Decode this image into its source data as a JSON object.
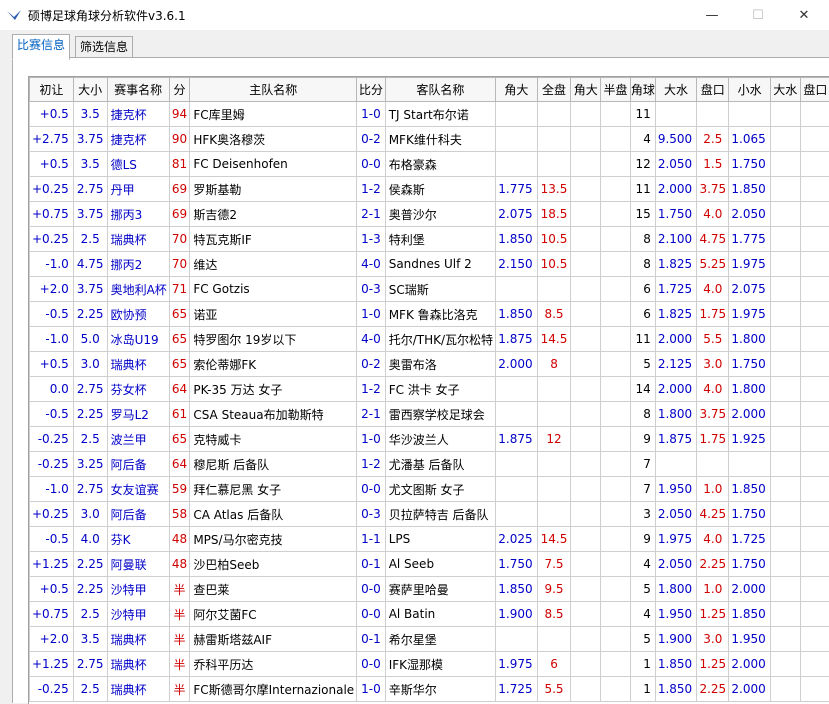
{
  "window": {
    "title": "硕博足球角球分析软件v3.6.1",
    "min_glyph": "—",
    "max_glyph": "☐",
    "close_glyph": "✕"
  },
  "tabs": [
    {
      "label": "比赛信息",
      "active": true
    },
    {
      "label": "筛选信息",
      "active": false
    }
  ],
  "grid": {
    "headers": [
      "初让",
      "大小",
      "赛事名称",
      "分",
      "主队名称",
      "比分",
      "客队名称",
      "角大",
      "全盘",
      "角大",
      "半盘",
      "角球",
      "大水",
      "盘口",
      "小水",
      "大水",
      "盘口"
    ],
    "rows": [
      [
        "+0.5",
        "3.5",
        "捷克杯",
        "94",
        "FC库里姆",
        "1-0",
        "TJ Start布尔诺",
        "",
        "",
        "",
        "",
        "11",
        "",
        "",
        ""
      ],
      [
        "+2.75",
        "3.75",
        "捷克杯",
        "90",
        "HFK奥洛穆茨",
        "0-2",
        "MFK维什科夫",
        "",
        "",
        "",
        "",
        "4",
        "9.500",
        "2.5",
        "1.065"
      ],
      [
        "+0.5",
        "3.5",
        "德LS",
        "81",
        "FC Deisenhofen",
        "0-0",
        "布格豪森",
        "",
        "",
        "",
        "",
        "12",
        "2.050",
        "1.5",
        "1.750"
      ],
      [
        "+0.25",
        "2.75",
        "丹甲",
        "69",
        "罗斯基勒",
        "1-2",
        "侯森斯",
        "1.775",
        "13.5",
        "",
        "",
        "11",
        "2.000",
        "3.75",
        "1.850"
      ],
      [
        "+0.75",
        "3.75",
        "挪丙3",
        "69",
        "斯吉德2",
        "2-1",
        "奥普沙尔",
        "2.075",
        "18.5",
        "",
        "",
        "15",
        "1.750",
        "4.0",
        "2.050"
      ],
      [
        "+0.25",
        "2.5",
        "瑞典杯",
        "70",
        "特瓦克斯IF",
        "1-3",
        "特利堡",
        "1.850",
        "10.5",
        "",
        "",
        "8",
        "2.100",
        "4.75",
        "1.775"
      ],
      [
        "-1.0",
        "4.75",
        "挪丙2",
        "70",
        "维达",
        "4-0",
        "Sandnes Ulf 2",
        "2.150",
        "10.5",
        "",
        "",
        "8",
        "1.825",
        "5.25",
        "1.975"
      ],
      [
        "+2.0",
        "3.75",
        "奥地利A杯",
        "71",
        "FC Gotzis",
        "0-3",
        "SC瑞斯",
        "",
        "",
        "",
        "",
        "6",
        "1.725",
        "4.0",
        "2.075"
      ],
      [
        "-0.5",
        "2.25",
        "欧协预",
        "65",
        "诺亚",
        "1-0",
        "MFK 鲁森比洛克",
        "1.850",
        "8.5",
        "",
        "",
        "6",
        "1.825",
        "1.75",
        "1.975"
      ],
      [
        "-1.0",
        "5.0",
        "冰岛U19",
        "65",
        "特罗图尔 19岁以下",
        "4-0",
        "托尔/THK/瓦尔松特",
        "1.875",
        "14.5",
        "",
        "",
        "11",
        "2.000",
        "5.5",
        "1.800"
      ],
      [
        "+0.5",
        "3.0",
        "瑞典杯",
        "65",
        "索伦蒂娜FK",
        "0-2",
        "奥雷布洛",
        "2.000",
        "8",
        "",
        "",
        "5",
        "2.125",
        "3.0",
        "1.750"
      ],
      [
        "0.0",
        "2.75",
        "芬女杯",
        "64",
        "PK-35 万达 女子",
        "1-2",
        "FC 洪卡 女子",
        "",
        "",
        "",
        "",
        "14",
        "2.000",
        "4.0",
        "1.800"
      ],
      [
        "-0.5",
        "2.25",
        "罗马L2",
        "61",
        "CSA Steaua布加勒斯特",
        "2-1",
        "雷西察学校足球会",
        "",
        "",
        "",
        "",
        "8",
        "1.800",
        "3.75",
        "2.000"
      ],
      [
        "-0.25",
        "2.5",
        "波兰甲",
        "65",
        "克特威卡",
        "1-0",
        "华沙波兰人",
        "1.875",
        "12",
        "",
        "",
        "9",
        "1.875",
        "1.75",
        "1.925"
      ],
      [
        "-0.25",
        "3.25",
        "阿后备",
        "64",
        "穆尼斯 后备队",
        "1-2",
        "尤潘基 后备队",
        "",
        "",
        "",
        "",
        "7",
        "",
        "",
        ""
      ],
      [
        "-1.0",
        "2.75",
        "女友谊赛",
        "59",
        "拜仁慕尼黑 女子",
        "0-0",
        "尤文图斯 女子",
        "",
        "",
        "",
        "",
        "7",
        "1.950",
        "1.0",
        "1.850"
      ],
      [
        "+0.25",
        "3.0",
        "阿后备",
        "58",
        "CA Atlas 后备队",
        "0-3",
        "贝拉萨特吉 后备队",
        "",
        "",
        "",
        "",
        "3",
        "2.050",
        "4.25",
        "1.750"
      ],
      [
        "-0.5",
        "4.0",
        "芬K",
        "48",
        "MPS/马尔密克技",
        "1-1",
        "LPS",
        "2.025",
        "14.5",
        "",
        "",
        "9",
        "1.975",
        "4.0",
        "1.725"
      ],
      [
        "+1.25",
        "2.25",
        "阿曼联",
        "48",
        "沙巴柏Seeb",
        "0-1",
        "Al Seeb",
        "1.750",
        "7.5",
        "",
        "",
        "4",
        "2.050",
        "2.25",
        "1.750"
      ],
      [
        "+0.5",
        "2.25",
        "沙特甲",
        "半",
        "查巴莱",
        "0-0",
        "赛萨里哈曼",
        "1.850",
        "9.5",
        "",
        "",
        "5",
        "1.800",
        "1.0",
        "2.000"
      ],
      [
        "+0.75",
        "2.5",
        "沙特甲",
        "半",
        "阿尔艾菌FC",
        "0-0",
        "Al Batin",
        "1.900",
        "8.5",
        "",
        "",
        "4",
        "1.950",
        "1.25",
        "1.850"
      ],
      [
        "+2.0",
        "3.5",
        "瑞典杯",
        "半",
        "赫雷斯塔兹AIF",
        "0-1",
        "希尔星堡",
        "",
        "",
        "",
        "",
        "5",
        "1.900",
        "3.0",
        "1.950"
      ],
      [
        "+1.25",
        "2.75",
        "瑞典杯",
        "半",
        "乔科平历达",
        "0-0",
        "IFK湿那模",
        "1.975",
        "6",
        "",
        "",
        "1",
        "1.850",
        "1.25",
        "2.000"
      ],
      [
        "-0.25",
        "2.5",
        "瑞典杯",
        "半",
        "FC斯德哥尔摩Internazionale",
        "1-0",
        "辛斯华尔",
        "1.725",
        "5.5",
        "",
        "",
        "1",
        "1.850",
        "2.25",
        "2.000"
      ]
    ]
  },
  "colors": {
    "blue": "#0000c8",
    "red": "#d00000",
    "header_bg": "#f7f7f7"
  }
}
